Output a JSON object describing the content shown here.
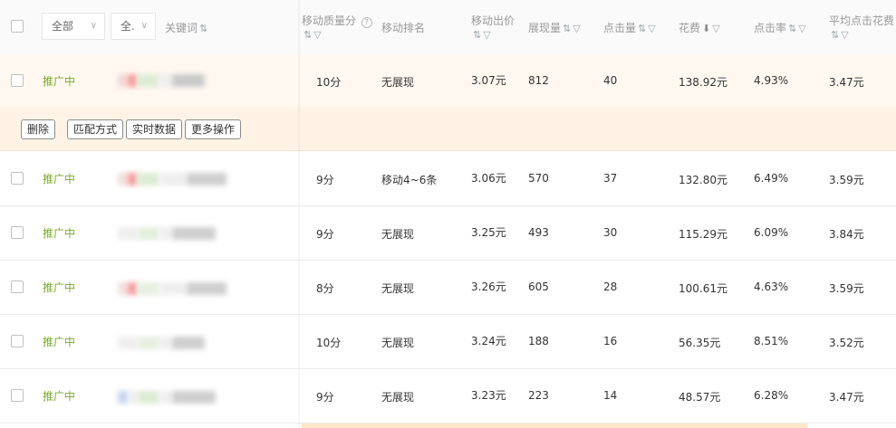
{
  "header": {
    "filter_all": "全部",
    "filter_second": "全.",
    "keyword": "关键词",
    "mobile_quality_score": "移动质量分",
    "mobile_rank": "移动排名",
    "mobile_bid": "移动出价",
    "impressions": "展现量",
    "clicks": "点击量",
    "cost": "花费",
    "ctr": "点击率",
    "avg_cpc": "平均点击花费"
  },
  "icons": {
    "sort": "⇅",
    "filter": "▽",
    "sort_desc": "⬇",
    "help": "?",
    "chevron": "∨"
  },
  "actions": {
    "delete": "删除",
    "match_type": "匹配方式",
    "realtime_data": "实时数据",
    "more_actions": "更多操作"
  },
  "rows": [
    {
      "status": "推广中",
      "quality": "10分",
      "rank": "无展现",
      "bid": "3.07元",
      "impressions": "812",
      "clicks": "40",
      "cost": "138.92元",
      "ctr": "4.93%",
      "cpc": "3.47元"
    },
    {
      "status": "推广中",
      "quality": "9分",
      "rank": "移动4~6条",
      "bid": "3.06元",
      "impressions": "570",
      "clicks": "37",
      "cost": "132.80元",
      "ctr": "6.49%",
      "cpc": "3.59元"
    },
    {
      "status": "推广中",
      "quality": "9分",
      "rank": "无展现",
      "bid": "3.25元",
      "impressions": "493",
      "clicks": "30",
      "cost": "115.29元",
      "ctr": "6.09%",
      "cpc": "3.84元"
    },
    {
      "status": "推广中",
      "quality": "8分",
      "rank": "无展现",
      "bid": "3.26元",
      "impressions": "605",
      "clicks": "28",
      "cost": "100.61元",
      "ctr": "4.63%",
      "cpc": "3.59元"
    },
    {
      "status": "推广中",
      "quality": "10分",
      "rank": "无展现",
      "bid": "3.24元",
      "impressions": "188",
      "clicks": "16",
      "cost": "56.35元",
      "ctr": "8.51%",
      "cpc": "3.52元"
    },
    {
      "status": "推广中",
      "quality": "9分",
      "rank": "无展现",
      "bid": "3.23元",
      "impressions": "223",
      "clicks": "14",
      "cost": "48.57元",
      "ctr": "6.28%",
      "cpc": "3.47元"
    }
  ]
}
